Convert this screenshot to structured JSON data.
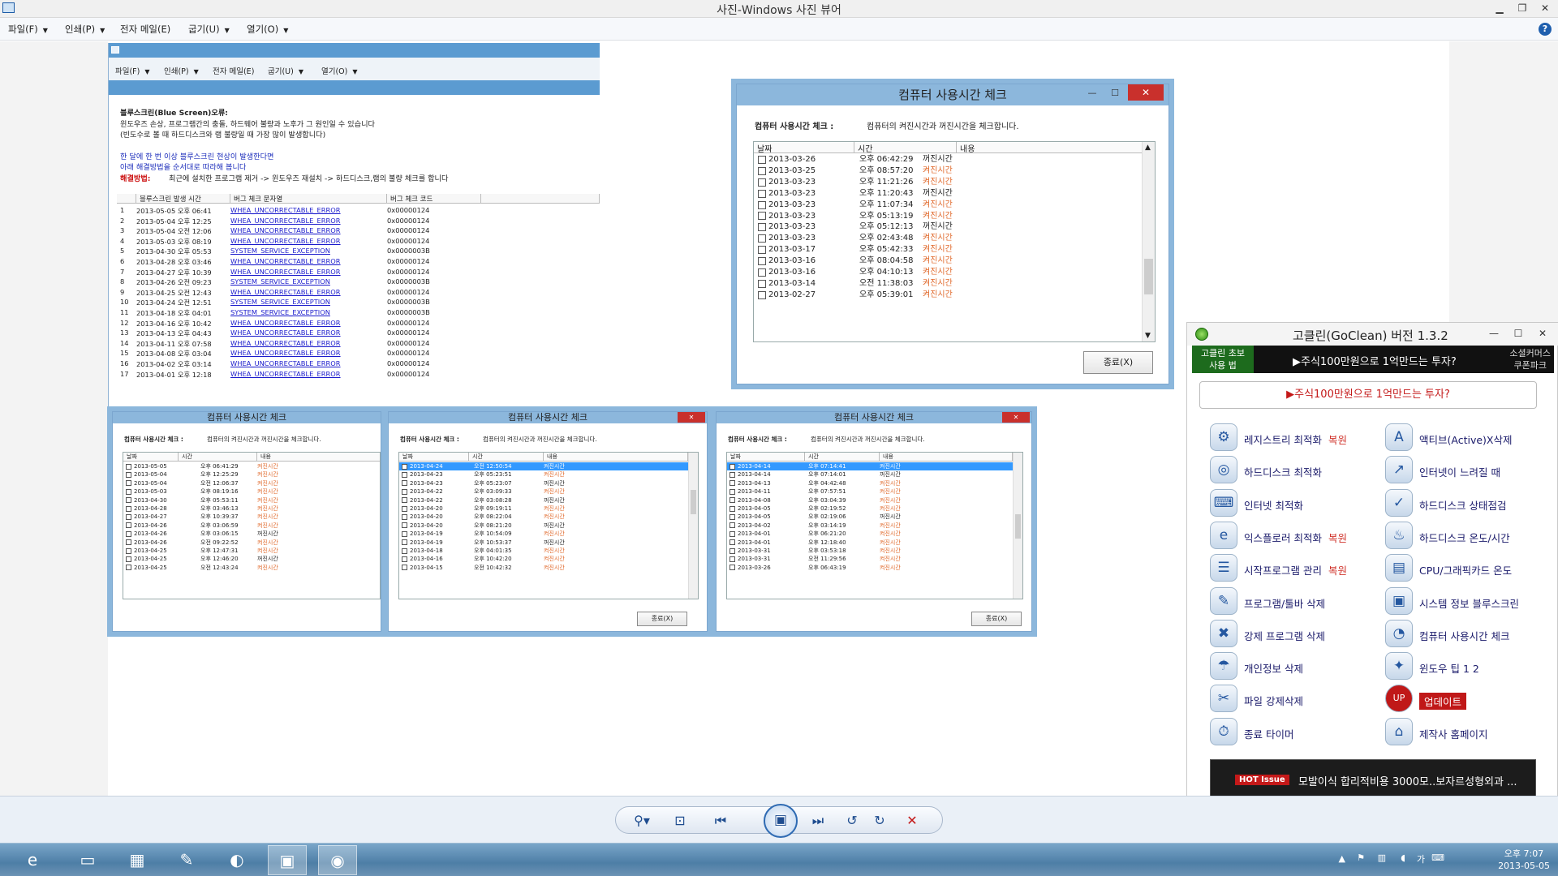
{
  "viewer": {
    "title": "사진-Windows 사진 뷰어",
    "menu": [
      "파일(F)",
      "인쇄(P)",
      "전자 메일(E)",
      "굽기(U)",
      "열기(O)"
    ]
  },
  "bsod": {
    "menu": [
      "파일(F)",
      "인쇄(P)",
      "전자 메일(E)",
      "굽기(U)",
      "열기(O)"
    ],
    "heading": "블루스크린(Blue Screen)오류:",
    "line1": "윈도우즈 손상, 프로그램간의 충돌, 하드웨어 불량과 노후가 그 원인일 수 있습니다",
    "line2": "(빈도수로 볼 때 하드디스크와 램 불량일 때 가장 많이 발생합니다)",
    "blue1": "한 달에 한 번 이상 블루스크린 현상이 발생한다면",
    "blue2": "아래 해결방법을 순서대로 따라해 봅니다",
    "fix_label": "해결방법:",
    "fix_text": "최근에 설치한 프로그램 제거 -> 윈도우즈 재설치 -> 하드디스크,램의 불량 체크를 합니다",
    "columns": [
      "블루스크린 발생 시간",
      "버그 체크 문자열",
      "버그 체크 코드"
    ],
    "rows": [
      [
        "1",
        "2013-05-05 오후 06:41",
        "WHEA_UNCORRECTABLE_ERROR",
        "0x00000124"
      ],
      [
        "2",
        "2013-05-04 오후 12:25",
        "WHEA_UNCORRECTABLE_ERROR",
        "0x00000124"
      ],
      [
        "3",
        "2013-05-04 오전 12:06",
        "WHEA_UNCORRECTABLE_ERROR",
        "0x00000124"
      ],
      [
        "4",
        "2013-05-03 오후 08:19",
        "WHEA_UNCORRECTABLE_ERROR",
        "0x00000124"
      ],
      [
        "5",
        "2013-04-30 오후 05:53",
        "SYSTEM_SERVICE_EXCEPTION",
        "0x0000003B"
      ],
      [
        "6",
        "2013-04-28 오후 03:46",
        "WHEA_UNCORRECTABLE_ERROR",
        "0x00000124"
      ],
      [
        "7",
        "2013-04-27 오후 10:39",
        "WHEA_UNCORRECTABLE_ERROR",
        "0x00000124"
      ],
      [
        "8",
        "2013-04-26 오전 09:23",
        "SYSTEM_SERVICE_EXCEPTION",
        "0x0000003B"
      ],
      [
        "9",
        "2013-04-25 오전 12:43",
        "WHEA_UNCORRECTABLE_ERROR",
        "0x00000124"
      ],
      [
        "10",
        "2013-04-24 오전 12:51",
        "SYSTEM_SERVICE_EXCEPTION",
        "0x0000003B"
      ],
      [
        "11",
        "2013-04-18 오후 04:01",
        "SYSTEM_SERVICE_EXCEPTION",
        "0x0000003B"
      ],
      [
        "12",
        "2013-04-16 오후 10:42",
        "WHEA_UNCORRECTABLE_ERROR",
        "0x00000124"
      ],
      [
        "13",
        "2013-04-13 오후 04:43",
        "WHEA_UNCORRECTABLE_ERROR",
        "0x00000124"
      ],
      [
        "14",
        "2013-04-11 오후 07:58",
        "WHEA_UNCORRECTABLE_ERROR",
        "0x00000124"
      ],
      [
        "15",
        "2013-04-08 오후 03:04",
        "WHEA_UNCORRECTABLE_ERROR",
        "0x00000124"
      ],
      [
        "16",
        "2013-04-02 오후 03:14",
        "WHEA_UNCORRECTABLE_ERROR",
        "0x00000124"
      ],
      [
        "17",
        "2013-04-01 오후 12:18",
        "WHEA_UNCORRECTABLE_ERROR",
        "0x00000124"
      ]
    ]
  },
  "check_dialog": {
    "title": "컴퓨터 사용시간 체크",
    "label": "컴퓨터 사용시간 체크 :",
    "desc": "컴퓨터의 켜진시간과 꺼진시간을 체크합니다.",
    "columns": [
      "날짜",
      "시간",
      "내용"
    ],
    "close_label": "종료(X)"
  },
  "main_log": [
    [
      "2013-03-26",
      "오후 06:42:29",
      "꺼진시간",
      false
    ],
    [
      "2013-03-25",
      "오후 08:57:20",
      "켜진시간",
      true
    ],
    [
      "2013-03-23",
      "오후 11:21:26",
      "켜진시간",
      true
    ],
    [
      "2013-03-23",
      "오후 11:20:43",
      "꺼진시간",
      false
    ],
    [
      "2013-03-23",
      "오후 11:07:34",
      "켜진시간",
      true
    ],
    [
      "2013-03-23",
      "오후 05:13:19",
      "켜진시간",
      true
    ],
    [
      "2013-03-23",
      "오후 05:12:13",
      "꺼진시간",
      false
    ],
    [
      "2013-03-23",
      "오후 02:43:48",
      "켜진시간",
      true
    ],
    [
      "2013-03-17",
      "오후 05:42:33",
      "켜진시간",
      true
    ],
    [
      "2013-03-16",
      "오후 08:04:58",
      "켜진시간",
      true
    ],
    [
      "2013-03-16",
      "오후 04:10:13",
      "켜진시간",
      true
    ],
    [
      "2013-03-14",
      "오전 11:38:03",
      "켜진시간",
      true
    ],
    [
      "2013-02-27",
      "오후 05:39:01",
      "켜진시간",
      true
    ]
  ],
  "log_a": [
    [
      "2013-05-05",
      "오후 06:41:29",
      "켜진시간",
      true
    ],
    [
      "2013-05-04",
      "오후 12:25:29",
      "켜진시간",
      true
    ],
    [
      "2013-05-04",
      "오전 12:06:37",
      "켜진시간",
      true
    ],
    [
      "2013-05-03",
      "오후 08:19:16",
      "켜진시간",
      true
    ],
    [
      "2013-04-30",
      "오후 05:53:11",
      "켜진시간",
      true
    ],
    [
      "2013-04-28",
      "오후 03:46:13",
      "켜진시간",
      true
    ],
    [
      "2013-04-27",
      "오후 10:39:37",
      "켜진시간",
      true
    ],
    [
      "2013-04-26",
      "오후 03:06:59",
      "켜진시간",
      true
    ],
    [
      "2013-04-26",
      "오후 03:06:15",
      "꺼진시간",
      false
    ],
    [
      "2013-04-26",
      "오전 09:22:52",
      "켜진시간",
      true
    ],
    [
      "2013-04-25",
      "오후 12:47:31",
      "켜진시간",
      true
    ],
    [
      "2013-04-25",
      "오후 12:46:20",
      "꺼진시간",
      false
    ],
    [
      "2013-04-25",
      "오전 12:43:24",
      "켜진시간",
      true
    ]
  ],
  "log_b": [
    [
      "2013-04-24",
      "오전 12:50:54",
      "켜진시간",
      true
    ],
    [
      "2013-04-23",
      "오후 05:23:51",
      "켜진시간",
      true
    ],
    [
      "2013-04-23",
      "오후 05:23:07",
      "꺼진시간",
      false
    ],
    [
      "2013-04-22",
      "오후 03:09:33",
      "켜진시간",
      true
    ],
    [
      "2013-04-22",
      "오후 03:08:28",
      "꺼진시간",
      false
    ],
    [
      "2013-04-20",
      "오후 09:19:11",
      "켜진시간",
      true
    ],
    [
      "2013-04-20",
      "오후 08:22:04",
      "켜진시간",
      true
    ],
    [
      "2013-04-20",
      "오후 08:21:20",
      "꺼진시간",
      false
    ],
    [
      "2013-04-19",
      "오후 10:54:09",
      "켜진시간",
      true
    ],
    [
      "2013-04-19",
      "오후 10:53:37",
      "꺼진시간",
      false
    ],
    [
      "2013-04-18",
      "오후 04:01:35",
      "켜진시간",
      true
    ],
    [
      "2013-04-16",
      "오후 10:42:20",
      "켜진시간",
      true
    ],
    [
      "2013-04-15",
      "오전 10:42:32",
      "켜진시간",
      true
    ]
  ],
  "log_c": [
    [
      "2013-04-14",
      "오후 07:14:41",
      "켜진시간",
      true
    ],
    [
      "2013-04-14",
      "오후 07:14:01",
      "꺼진시간",
      false
    ],
    [
      "2013-04-13",
      "오후 04:42:48",
      "켜진시간",
      true
    ],
    [
      "2013-04-11",
      "오후 07:57:51",
      "켜진시간",
      true
    ],
    [
      "2013-04-08",
      "오후 03:04:39",
      "켜진시간",
      true
    ],
    [
      "2013-04-05",
      "오후 02:19:52",
      "켜진시간",
      true
    ],
    [
      "2013-04-05",
      "오후 02:19:06",
      "꺼진시간",
      false
    ],
    [
      "2013-04-02",
      "오후 03:14:19",
      "켜진시간",
      true
    ],
    [
      "2013-04-01",
      "오후 06:21:20",
      "켜진시간",
      true
    ],
    [
      "2013-04-01",
      "오후 12:18:40",
      "켜진시간",
      true
    ],
    [
      "2013-03-31",
      "오후 03:53:18",
      "켜진시간",
      true
    ],
    [
      "2013-03-31",
      "오전 11:29:56",
      "켜진시간",
      true
    ],
    [
      "2013-03-26",
      "오후 06:43:19",
      "켜진시간",
      true
    ]
  ],
  "goclean": {
    "title": "고클린(GoClean) 버전 1.3.2",
    "banner_left": [
      "고클린 초보",
      "사용 법"
    ],
    "banner_mid": "▶주식100만원으로 1억만드는 투자?",
    "banner_right": [
      "소셜커머스",
      "쿠폰파크"
    ],
    "ad_text": "▶주식100만원으로 1억만드는 투자?",
    "left_items": [
      {
        "label": "레지스트리 최적화",
        "extra": "복원",
        "icon": "registry-icon"
      },
      {
        "label": "하드디스크 최적화",
        "extra": "",
        "icon": "disk-clean-icon"
      },
      {
        "label": "인터넷 최적화",
        "extra": "",
        "icon": "internet-icon"
      },
      {
        "label": "익스플로러 최적화",
        "extra": "복원",
        "icon": "ie-icon"
      },
      {
        "label": "시작프로그램 관리",
        "extra": "복원",
        "icon": "startup-icon"
      },
      {
        "label": "프로그램/툴바 삭제",
        "extra": "",
        "icon": "uninstall-icon"
      },
      {
        "label": "강제 프로그램 삭제",
        "extra": "",
        "icon": "force-delete-icon"
      },
      {
        "label": "개인정보 삭제",
        "extra": "",
        "icon": "privacy-icon"
      },
      {
        "label": "파일 강제삭제",
        "extra": "",
        "icon": "file-delete-icon"
      },
      {
        "label": "종료 타이머",
        "extra": "",
        "icon": "timer-icon"
      }
    ],
    "right_items": [
      {
        "label": "액티브(Active)X삭제",
        "icon": "activex-icon"
      },
      {
        "label": "인터넷이 느려질 때",
        "icon": "slow-internet-icon"
      },
      {
        "label": "하드디스크 상태점검",
        "icon": "disk-check-icon"
      },
      {
        "label": "하드디스크 온도/시간",
        "icon": "disk-temp-icon"
      },
      {
        "label": "CPU/그래픽카드 온도",
        "icon": "cpu-temp-icon"
      },
      {
        "label": "시스템 정보 블루스크린",
        "icon": "system-info-icon"
      },
      {
        "label": "컴퓨터 사용시간 체크",
        "icon": "clock-icon"
      },
      {
        "label": "윈도우 팁 1   2",
        "icon": "tip-icon"
      },
      {
        "label": "업데이트",
        "icon": "update-icon"
      },
      {
        "label": "제작사 홈페이지",
        "icon": "home-icon"
      }
    ],
    "hot_tag": "HOT Issue",
    "hot_text": "모발이식 합리적비용 3000모..보자르성형외과 ..."
  },
  "clock": {
    "time": "오후 7:07",
    "date": "2013-05-05"
  },
  "tray_ime": "가"
}
